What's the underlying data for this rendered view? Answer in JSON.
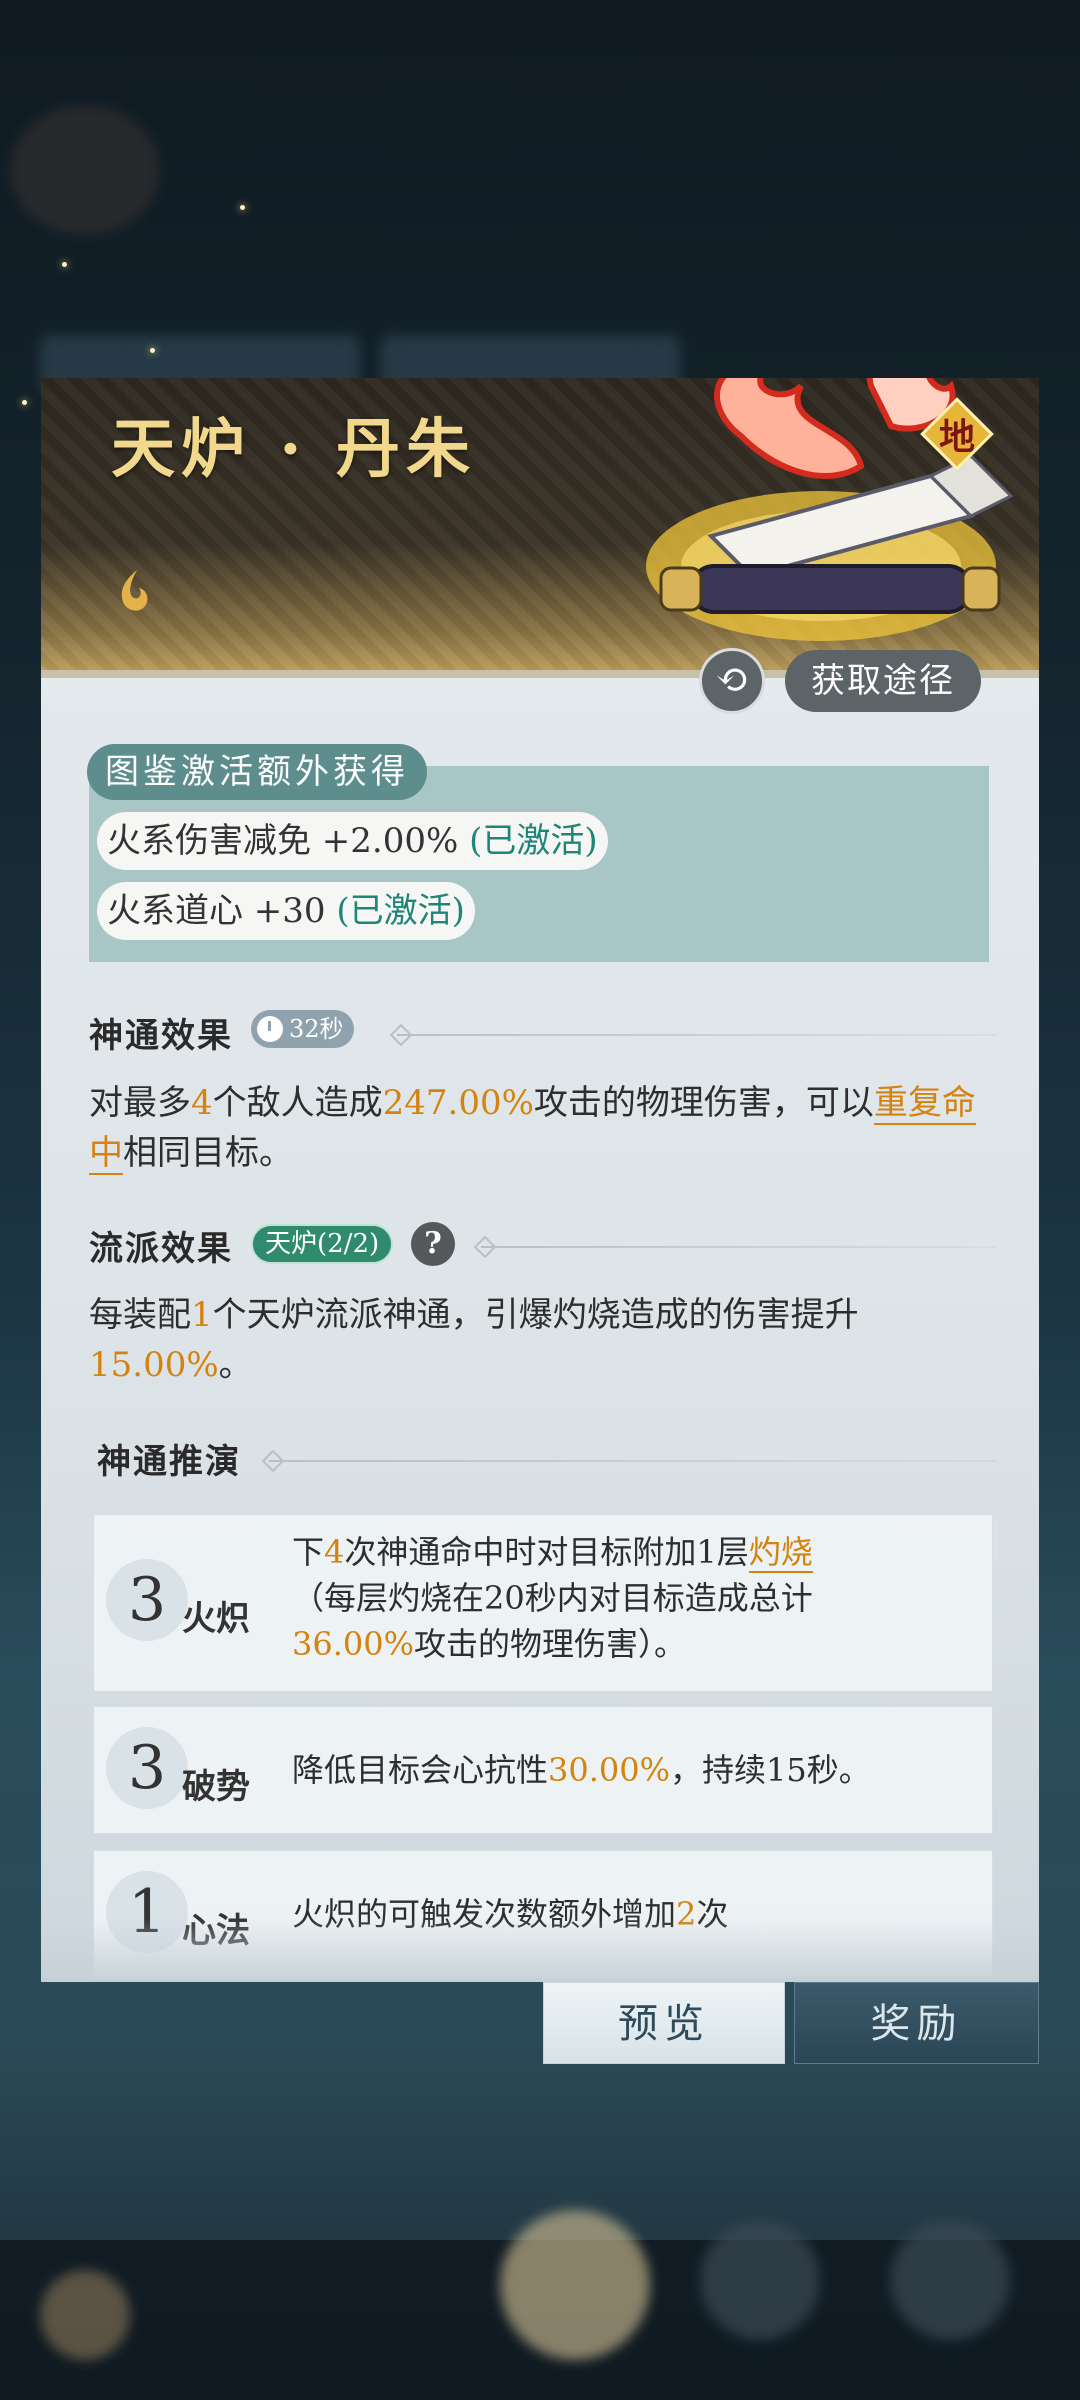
{
  "card": {
    "title": "天炉 · 丹朱",
    "grade": "地",
    "element_icon": "flame-icon",
    "source_button": "获取途径",
    "refresh_icon": "refresh-icon"
  },
  "collection_bonus": {
    "tag": "图鉴激活额外获得",
    "rows": [
      {
        "text": "火系伤害减免 +2.00% ",
        "status": "(已激活)"
      },
      {
        "text": "火系道心 +30 ",
        "status": "(已激活)"
      }
    ]
  },
  "effect": {
    "title": "神通效果",
    "cooldown": "32秒",
    "desc_1": "对最多",
    "desc_2": "4",
    "desc_3": "个敌人造成",
    "desc_4": "247.00%",
    "desc_5": "攻击的物理伤害，可以",
    "desc_6": "重复命中",
    "desc_7": "相同目标。"
  },
  "school": {
    "title": "流派效果",
    "badge": "天炉(2/2)",
    "help": "?",
    "desc_1": "每装配",
    "desc_2": "1",
    "desc_3": "个天炉流派神通，引爆灼烧造成的伤害提升",
    "desc_4": "15.00%",
    "desc_5": "。"
  },
  "deduction": {
    "title": "神通推演",
    "items": [
      {
        "level": "3",
        "name": "火炽",
        "d1": "下",
        "d2": "4",
        "d3": "次神通命中时对目标附加1层",
        "d4": "灼烧",
        "d5": "（每层灼烧在20秒内对目标造成总计",
        "d6": "36.00%",
        "d7": "攻击的物理伤害）。"
      },
      {
        "level": "3",
        "name": "破势",
        "d1": "降低目标会心抗性",
        "d2": "30.00%",
        "d3": "，持续15秒。"
      },
      {
        "level": "1",
        "name": "心法",
        "d1": "火炽的可触发次数额外增加",
        "d2": "2",
        "d3": "次"
      }
    ]
  },
  "tabs": {
    "preview": "预览",
    "reward": "奖励"
  }
}
